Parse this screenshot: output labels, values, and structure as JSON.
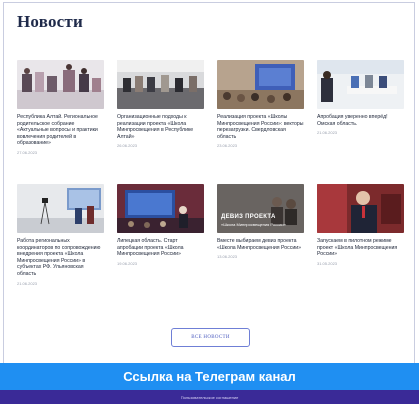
{
  "section_title": "Новости",
  "cards": [
    {
      "text": "Республика Алтай. Региональное родительское собрание «Актуальные вопросы и практики вовлечения родителей в образование»",
      "date": "27.06.2023"
    },
    {
      "text": "Организационные подходы к реализации проекта «Школа Минпросвещения в Республике Алтай»",
      "date": "26.06.2023"
    },
    {
      "text": "Реализация проекта «Школы Минпросвещения России»: векторы перезагрузки. Свердловская область",
      "date": "23.06.2023"
    },
    {
      "text": "Апробация уверенно вперёд! Омская область.",
      "date": "21.06.2023"
    },
    {
      "text": "Работа региональных координаторов по сопровождению внедрения проекта «Школа Минпросвещения России» в субъектах РФ. Ульяновская область",
      "date": "21.06.2023"
    },
    {
      "text": "Липецкая область. Старт апробации проекта «Школа Минпросвещения России»",
      "date": "19.06.2023"
    },
    {
      "text": "Вместе выбираем девиз проекта «Школа Минпросвещения России»",
      "date": "13.06.2023"
    },
    {
      "text": "Запускаем в пилотном режиме проект «Школа Минпросвещения России»",
      "date": "31.05.2023"
    }
  ],
  "thumb_overlay": {
    "title": "ДЕВИЗ ПРОЕКТА",
    "subtitle": "«Школа Минпросвещения России»"
  },
  "all_news_label": "ВСЕ НОВОСТИ",
  "telegram_label": "Ссылка на Телеграм канал",
  "footer_label": "Пользовательское соглашение",
  "colors": {
    "telegram_bar": "#1f8ff2",
    "footer": "#3a2a97",
    "button_border": "#6f7fd6"
  }
}
